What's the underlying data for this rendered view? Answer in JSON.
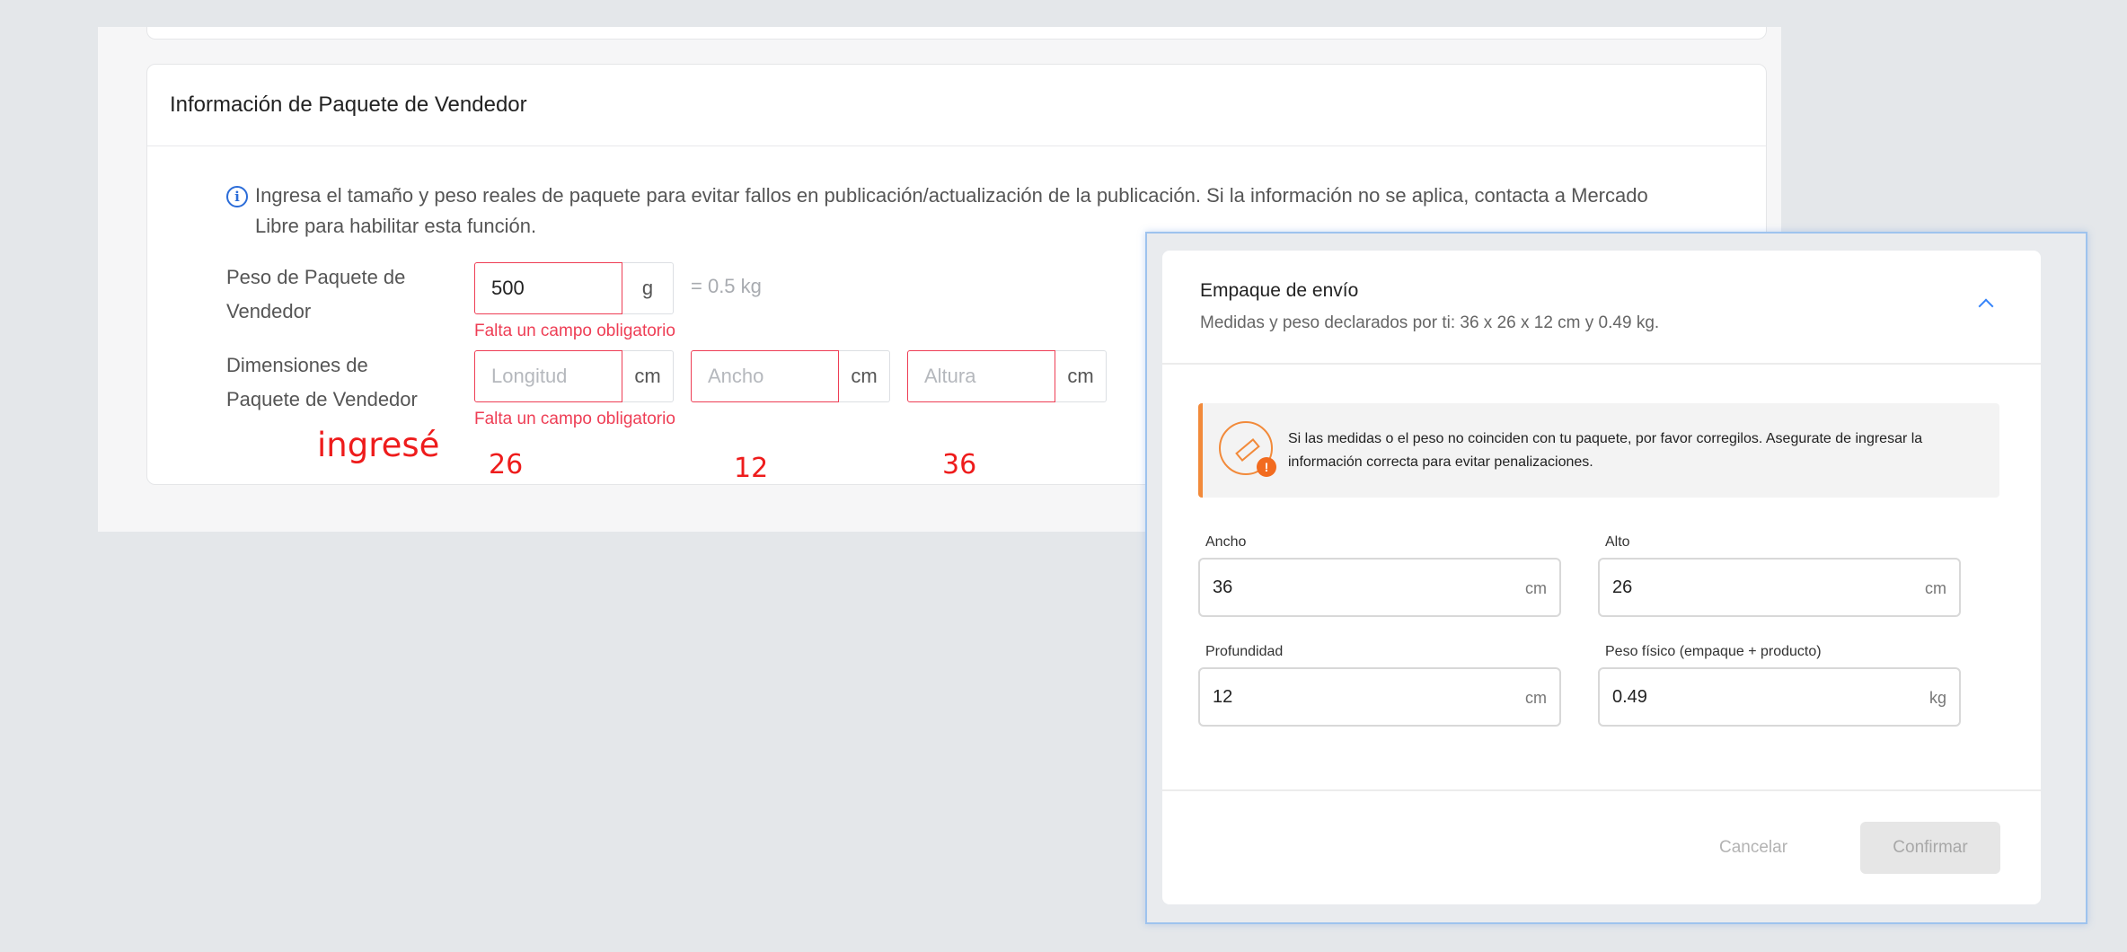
{
  "seller_package": {
    "title": "Información de Paquete de Vendedor",
    "notice": "Ingresa el tamaño y peso reales de paquete para evitar fallos en publicación/actualización de la publicación. Si la información no se aplica, contacta a Mercado Libre para habilitar esta función.",
    "weight": {
      "label": "Peso de Paquete de Vendedor",
      "value": "500",
      "unit": "g",
      "conversion": "= 0.5 kg",
      "error": "Falta un campo obligatorio"
    },
    "dimensions": {
      "label": "Dimensiones de Paquete de Vendedor",
      "fields": [
        {
          "placeholder": "Longitud",
          "unit": "cm"
        },
        {
          "placeholder": "Ancho",
          "unit": "cm"
        },
        {
          "placeholder": "Altura",
          "unit": "cm"
        }
      ],
      "error": "Falta un campo obligatorio"
    }
  },
  "annotations": {
    "entered": "ingresé",
    "values": [
      "26",
      "12",
      "36"
    ],
    "color": "#ee1c1c"
  },
  "modal": {
    "title": "Empaque de envío",
    "subtitle": "Medidas y peso declarados por ti: 36 x 26 x 12 cm y 0.49 kg.",
    "alert": "Si las medidas o el peso no coinciden con tu paquete, por favor corregilos. Asegurate de ingresar la información correcta para evitar penalizaciones.",
    "fields": {
      "width": {
        "label": "Ancho",
        "value": "36",
        "unit": "cm"
      },
      "height": {
        "label": "Alto",
        "value": "26",
        "unit": "cm"
      },
      "depth": {
        "label": "Profundidad",
        "value": "12",
        "unit": "cm"
      },
      "weight": {
        "label": "Peso físico (empaque + producto)",
        "value": "0.49",
        "unit": "kg"
      }
    },
    "cancel_label": "Cancelar",
    "confirm_label": "Confirmar"
  },
  "colors": {
    "error": "#ee3e55",
    "info": "#2b6cd8",
    "warning": "#f28a3a",
    "link": "#3483fa"
  }
}
